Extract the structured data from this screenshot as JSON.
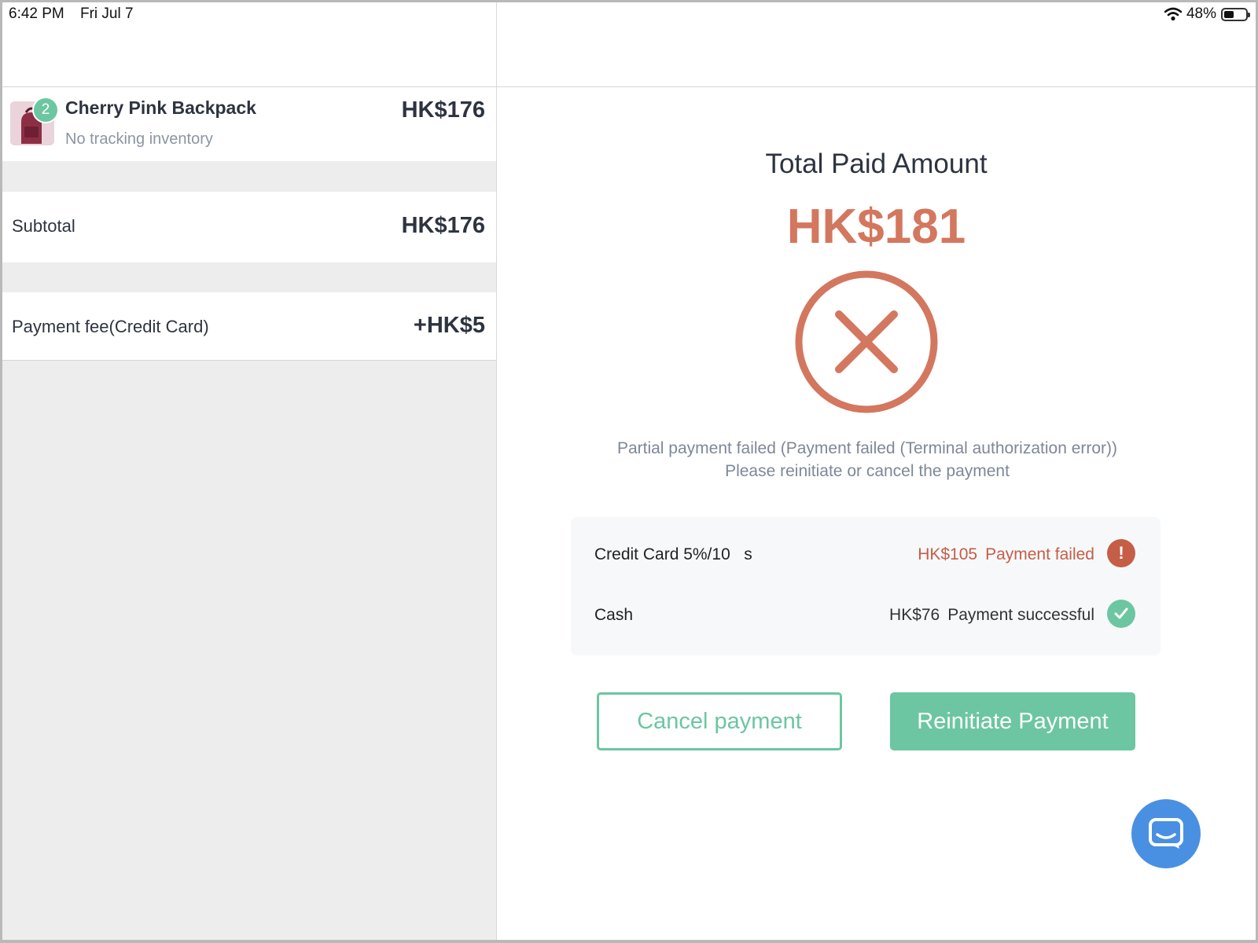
{
  "status_bar": {
    "time": "6:42 PM",
    "date": "Fri Jul 7",
    "battery_pct": "48%",
    "battery_level": 0.48
  },
  "cart": {
    "item": {
      "quantity": "2",
      "name": "Cherry Pink Backpack",
      "subtitle": "No tracking inventory",
      "price": "HK$176"
    },
    "subtotal": {
      "label": "Subtotal",
      "value": "HK$176"
    },
    "payment_fee": {
      "label": "Payment fee(Credit Card)",
      "value": "+HK$5"
    }
  },
  "result": {
    "title": "Total Paid Amount",
    "amount": "HK$181",
    "message": "Partial payment failed (Payment failed (Terminal authorization error)) Please reinitiate or cancel the payment",
    "icon": "x-circle-icon",
    "accent_color": "#d3775f"
  },
  "payments": [
    {
      "method": "Credit Card 5%/10   s",
      "amount": "HK$105",
      "status": "Payment failed",
      "icon": "exclamation-icon",
      "color": "#c55e47"
    },
    {
      "method": "Cash",
      "amount": "HK$76",
      "status": "Payment successful",
      "icon": "check-icon",
      "color": "#6cc6a1"
    }
  ],
  "actions": {
    "cancel_label": "Cancel payment",
    "reinitiate_label": "Reinitiate Payment"
  },
  "theme": {
    "primary": "#6cc6a1",
    "chat_button": "#4a90e2"
  }
}
